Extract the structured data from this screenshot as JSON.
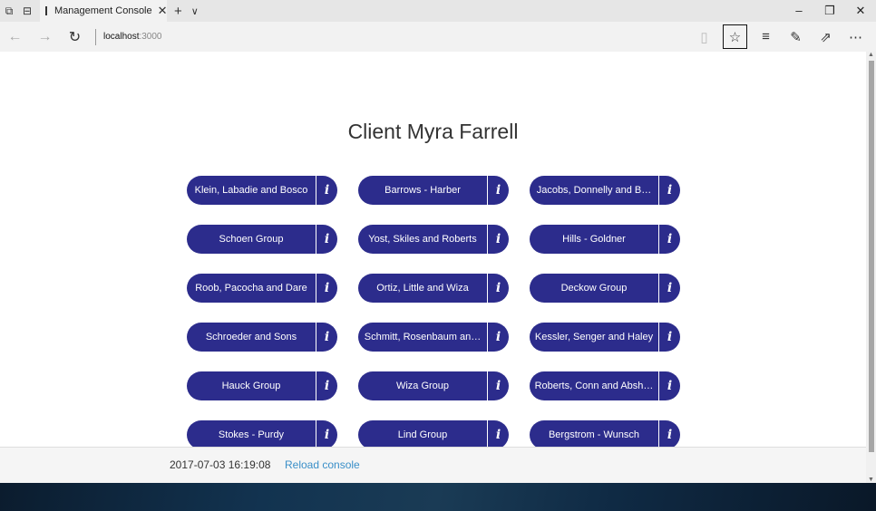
{
  "browser": {
    "tab_title": "Management Console",
    "url_host": "localhost",
    "url_port": ":3000",
    "window_controls": {
      "minimize": "–",
      "restore": "❐",
      "close": "✕"
    }
  },
  "page": {
    "title": "Client Myra Farrell",
    "clients": [
      "Klein, Labadie and Bosco",
      "Barrows - Harber",
      "Jacobs, Donnelly and B…",
      "Schoen Group",
      "Yost, Skiles and Roberts",
      "Hills - Goldner",
      "Roob, Pacocha and Dare",
      "Ortiz, Little and Wiza",
      "Deckow Group",
      "Schroeder and Sons",
      "Schmitt, Rosenbaum an…",
      "Kessler, Senger and Haley",
      "Hauck Group",
      "Wiza Group",
      "Roberts, Conn and Absh…",
      "Stokes - Purdy",
      "Lind Group",
      "Bergstrom - Wunsch"
    ],
    "info_glyph": "i"
  },
  "footer": {
    "timestamp": "2017-07-03 16:19:08",
    "reload_label": "Reload console"
  },
  "colors": {
    "button_bg": "#2c2c8c",
    "link": "#3a8fc8"
  }
}
